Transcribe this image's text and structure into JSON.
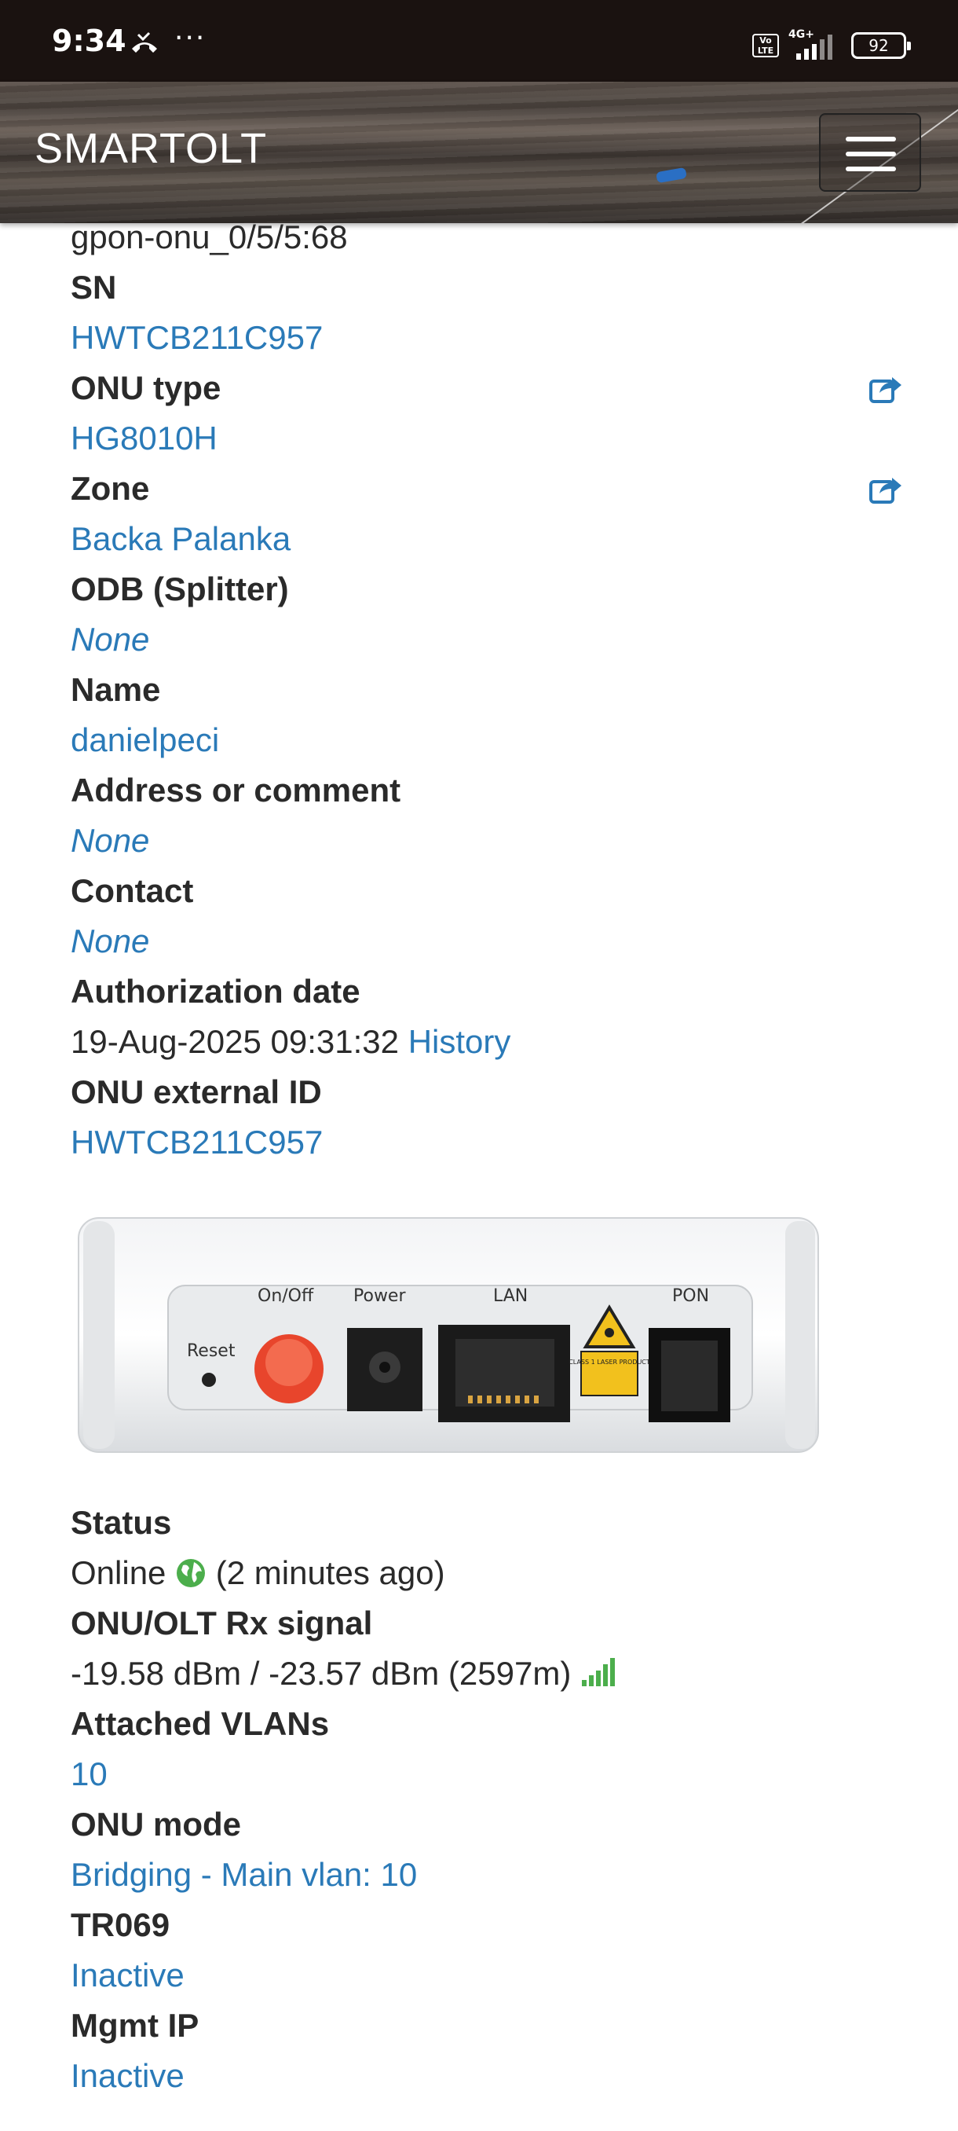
{
  "status_bar": {
    "time": "9:34",
    "dots": "···",
    "net": "4G+",
    "volte": "Vo LTE",
    "battery": "92"
  },
  "header": {
    "brand": "SMARTOLT"
  },
  "onu": {
    "interface_value": "gpon-onu_0/5/5:68",
    "sn_label": "SN",
    "sn_value": "HWTCB211C957",
    "type_label": "ONU type",
    "type_value": "HG8010H",
    "zone_label": "Zone",
    "zone_value": "Backa Palanka",
    "odb_label": "ODB (Splitter)",
    "odb_value": "None",
    "name_label": "Name",
    "name_value": "danielpeci",
    "address_label": "Address or comment",
    "address_value": "None",
    "contact_label": "Contact",
    "contact_value": "None",
    "auth_label": "Authorization date",
    "auth_value": "19-Aug-2025 09:31:32",
    "auth_history": "History",
    "ext_id_label": "ONU external ID",
    "ext_id_value": "HWTCB211C957"
  },
  "device_image": {
    "reset": "Reset",
    "onoff": "On/Off",
    "power": "Power",
    "lan": "LAN",
    "pon": "PON",
    "laser": "CLASS 1 LASER PRODUCT"
  },
  "status": {
    "status_label": "Status",
    "status_value": "Online",
    "status_ago": "(2 minutes ago)",
    "rx_label": "ONU/OLT Rx signal",
    "rx_value": "-19.58 dBm / -23.57 dBm (2597m)",
    "vlans_label": "Attached VLANs",
    "vlans_value": "10",
    "mode_label": "ONU mode",
    "mode_value": "Bridging - Main vlan: 10",
    "tr069_label": "TR069",
    "tr069_value": "Inactive",
    "mgmt_label": "Mgmt IP",
    "mgmt_value": "Inactive"
  },
  "colors": {
    "link": "#2a7ab8",
    "online": "#4cae4c",
    "navbar": "#4a423d"
  }
}
